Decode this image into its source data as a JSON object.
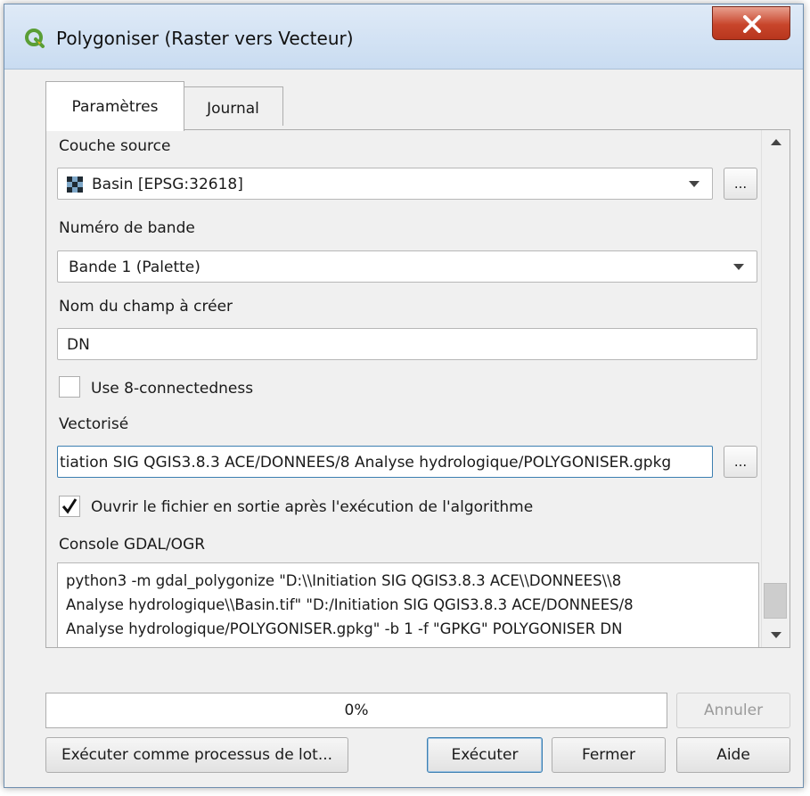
{
  "window": {
    "title": "Polygoniser (Raster vers Vecteur)",
    "close_glyph": "X",
    "app_icon": "qgis-logo-icon"
  },
  "tabs": [
    {
      "label": "Paramètres",
      "active": true
    },
    {
      "label": "Journal",
      "active": false
    }
  ],
  "params": {
    "source_layer": {
      "label": "Couche source",
      "value": "Basin [EPSG:32618]",
      "icon": "raster-layer-icon",
      "browse_label": "..."
    },
    "band": {
      "label": "Numéro de bande",
      "value": "Bande 1 (Palette)"
    },
    "field_name": {
      "label": "Nom du champ à créer",
      "value": "DN"
    },
    "connectedness": {
      "label": "Use 8-connectedness",
      "checked": false
    },
    "output": {
      "label": "Vectorisé",
      "value": "tiation SIG QGIS3.8.3 ACE/DONNEES/8 Analyse hydrologique/POLYGONISER.gpkg",
      "browse_label": "..."
    },
    "open_output": {
      "label": "Ouvrir le fichier en sortie après l'exécution de l'algorithme",
      "checked": true
    },
    "console": {
      "label": "Console GDAL/OGR",
      "lines": [
        "python3 -m gdal_polygonize \"D:\\\\Initiation SIG QGIS3.8.3 ACE\\\\DONNEES\\\\8",
        "Analyse hydrologique\\\\Basin.tif\" \"D:/Initiation SIG QGIS3.8.3 ACE/DONNEES/8",
        "Analyse hydrologique/POLYGONISER.gpkg\" -b 1 -f \"GPKG\" POLYGONISER DN"
      ]
    }
  },
  "progress": {
    "text": "0%",
    "value": 0
  },
  "buttons": {
    "cancel": "Annuler",
    "batch": "Exécuter comme processus de lot...",
    "run": "Exécuter",
    "close": "Fermer",
    "help": "Aide"
  },
  "colors": {
    "accent": "#3c7fb1",
    "close_red": "#c8452b",
    "progress_green": "#06b025"
  }
}
